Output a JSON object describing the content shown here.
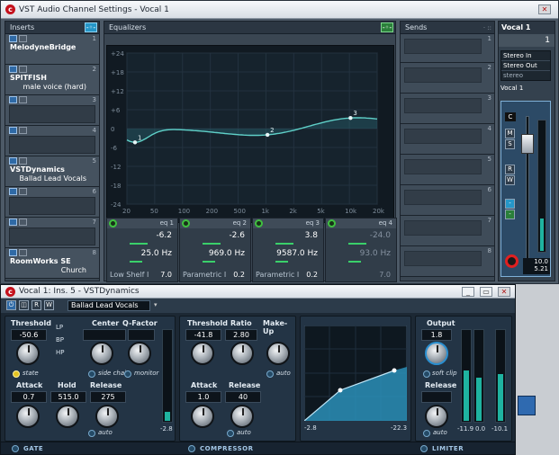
{
  "channel_window": {
    "title": "VST Audio Channel Settings - Vocal 1",
    "inserts_label": "Inserts",
    "equalizers_label": "Equalizers",
    "sends_label": "Sends",
    "inserts": [
      {
        "num": "1",
        "name": "MelodyneBridge",
        "preset": ""
      },
      {
        "num": "2",
        "name": "SPITFISH",
        "preset": "male voice (hard)"
      },
      {
        "num": "3",
        "name": "",
        "preset": ""
      },
      {
        "num": "4",
        "name": "",
        "preset": ""
      },
      {
        "num": "5",
        "name": "VSTDynamics",
        "preset": "Ballad Lead Vocals"
      },
      {
        "num": "6",
        "name": "",
        "preset": ""
      },
      {
        "num": "7",
        "name": "",
        "preset": ""
      },
      {
        "num": "8",
        "name": "RoomWorks SE",
        "preset": "Church"
      }
    ],
    "eq_db_ticks": [
      "+24",
      "+18",
      "+12",
      "+6",
      "0",
      "-6",
      "-12",
      "-18",
      "-24"
    ],
    "eq_freq_ticks": [
      "20",
      "50",
      "100",
      "200",
      "500",
      "1k",
      "2k",
      "5k",
      "10k",
      "20k"
    ],
    "eq_bands": [
      {
        "header": "eq 1",
        "gain": "-6.2",
        "freq": "25.0 Hz",
        "type": "Low Shelf I",
        "q": "7.0"
      },
      {
        "header": "eq 2",
        "gain": "-2.6",
        "freq": "969.0 Hz",
        "type": "Parametric I",
        "q": "0.2"
      },
      {
        "header": "eq 3",
        "gain": "3.8",
        "freq": "9587.0 Hz",
        "type": "Parametric I",
        "q": "0.2"
      },
      {
        "header": "eq 4",
        "gain": "-24.0",
        "freq": "93.0 Hz",
        "type": "",
        "q": "7.0"
      }
    ],
    "sends": [
      "1",
      "2",
      "3",
      "4",
      "5",
      "6",
      "7",
      "8"
    ],
    "strip": {
      "name": "Vocal 1",
      "number": "1",
      "routing_in": "Stereo In",
      "routing_out": "Stereo Out",
      "config": "stereo",
      "name2": "Vocal 1",
      "fader_value": "10.0",
      "peak_value": "5.21",
      "pan": "C",
      "btn_m": "M",
      "btn_s": "S",
      "btn_r": "R",
      "btn_w": "W"
    }
  },
  "dynamics_window": {
    "title": "Vocal 1: Ins. 5 - VSTDynamics",
    "preset": "Ballad Lead Vocals",
    "gate": {
      "threshold_label": "Threshold",
      "threshold": "-50.6",
      "center_label": "Center",
      "qfactor_label": "Q-Factor",
      "state_label": "state",
      "sidechain_label": "side chain",
      "monitor_label": "monitor",
      "lp": "LP",
      "bp": "BP",
      "hp": "HP",
      "attack_label": "Attack",
      "attack": "0.7",
      "hold_label": "Hold",
      "hold": "515.0",
      "release_label": "Release",
      "release": "275",
      "auto_label": "auto",
      "meter_value": "-2.8",
      "footer": "GATE"
    },
    "compressor": {
      "threshold_label": "Threshold",
      "threshold": "-41.8",
      "ratio_label": "Ratio",
      "ratio": "2.80",
      "makeup_label": "Make-Up",
      "auto_label": "auto",
      "attack_label": "Attack",
      "attack": "1.0",
      "release_label": "Release",
      "release": "40",
      "release_auto_label": "auto",
      "graph_min": "-2.8",
      "graph_max": "-22.3",
      "footer": "COMPRESSOR"
    },
    "limiter": {
      "output_label": "Output",
      "output": "1.8",
      "softclip_label": "soft clip",
      "release_label": "Release",
      "auto_label": "auto",
      "meter1": "-11.9",
      "meter2": "0.0",
      "meter3": "-10.1",
      "footer": "LIMITER"
    }
  }
}
